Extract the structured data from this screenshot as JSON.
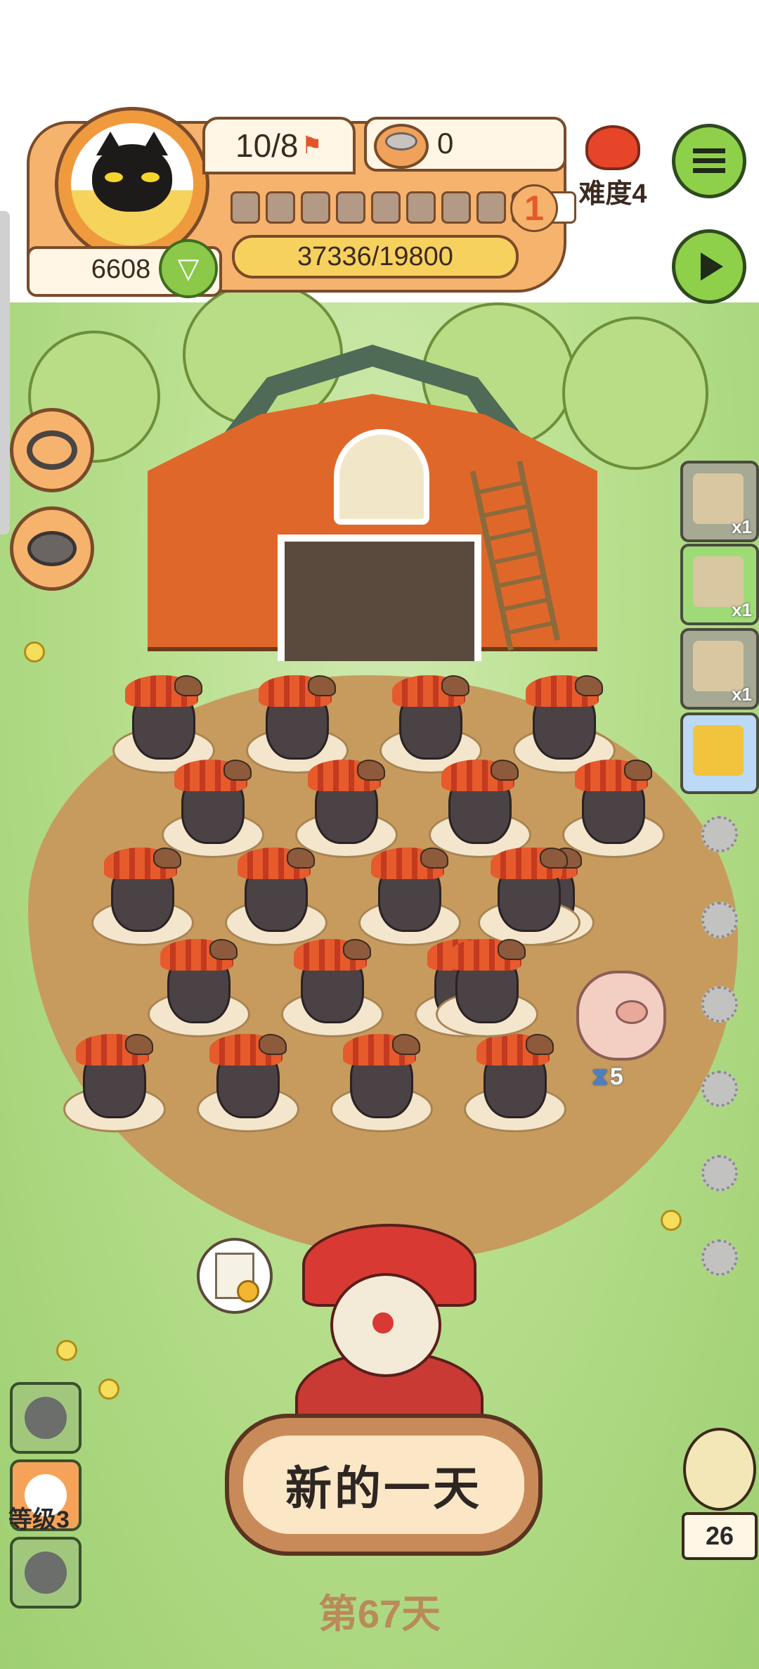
{
  "hud": {
    "coins": "6608",
    "progress_count": "10/8",
    "food_count": "0",
    "level": "1",
    "xp": "37336/19800",
    "segments_filled": 9,
    "segments_total": 10
  },
  "difficulty": {
    "label": "难度4"
  },
  "side_cards": [
    {
      "icon": "seed-pack-icon",
      "qty": "x1"
    },
    {
      "icon": "doghouse-icon",
      "qty": "x1"
    },
    {
      "icon": "barn-icon",
      "qty": "x1"
    },
    {
      "icon": "corn-feed-icon",
      "qty": ""
    }
  ],
  "left_buttons": [
    {
      "icon": "collar-icon"
    },
    {
      "icon": "food-bowl-icon"
    }
  ],
  "left_tools": {
    "level_label": "等级3"
  },
  "animals": {
    "turkey_count": 22,
    "pig_timer": "5"
  },
  "main": {
    "new_day_label": "新的一天",
    "day_label": "第67天"
  },
  "chick": {
    "count": "26"
  },
  "colors": {
    "accent_orange": "#f6b36d",
    "accent_green": "#8fd04a",
    "barn_red": "#e0672a",
    "dirt": "#c79b5e"
  }
}
